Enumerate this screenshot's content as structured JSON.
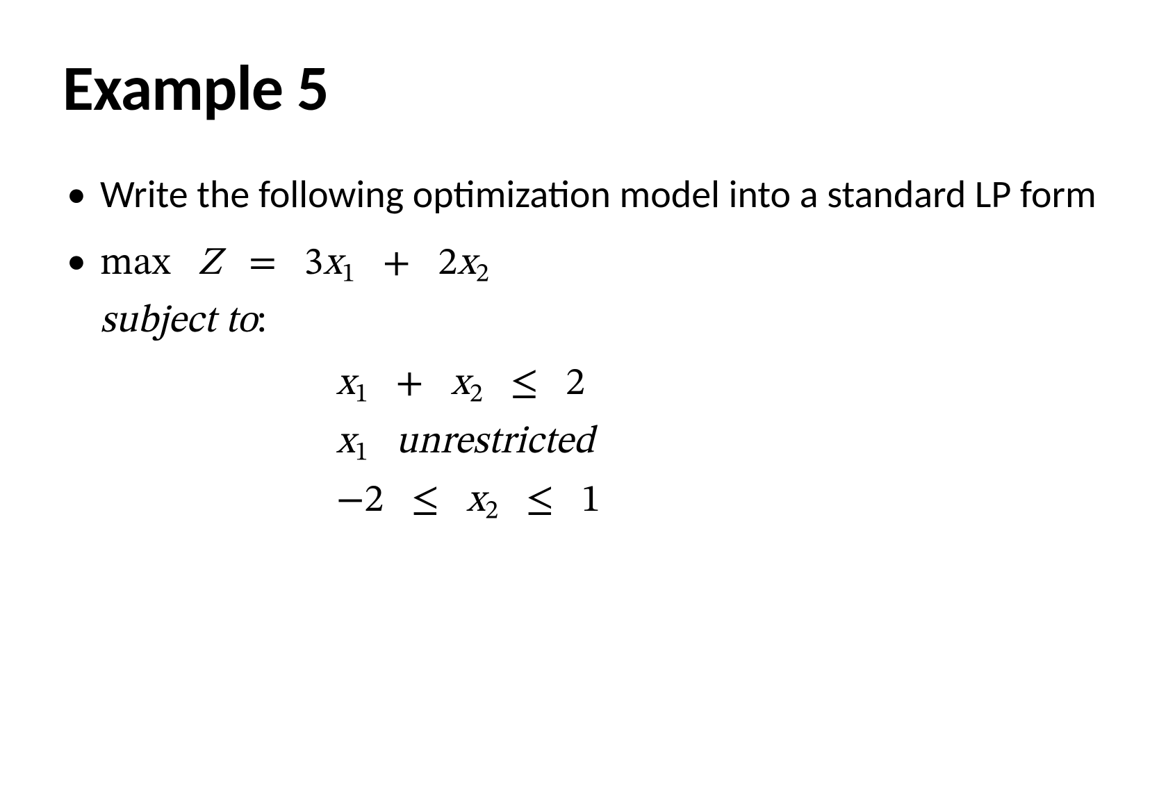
{
  "title": "Example 5",
  "bullet1": "Write the following optimization model into a standard LP form",
  "bullet2": {
    "max": "max",
    "Z": "Z",
    "eq": "=",
    "c1": "3",
    "x": "x",
    "s1": "1",
    "plus": "+",
    "c2": "2",
    "s2": "2",
    "subject_to": "subject to",
    "colon": ":"
  },
  "constraints": {
    "line1": {
      "x": "x",
      "s1": "1",
      "plus": "+",
      "s2": "2",
      "le": "≤",
      "rhs": "2"
    },
    "line2": {
      "x": "x",
      "s1": "1",
      "text": "unrestricted"
    },
    "line3": {
      "lhs": "−2",
      "le1": "≤",
      "x": "x",
      "s2": "2",
      "le2": "≤",
      "rhs": "1"
    }
  }
}
